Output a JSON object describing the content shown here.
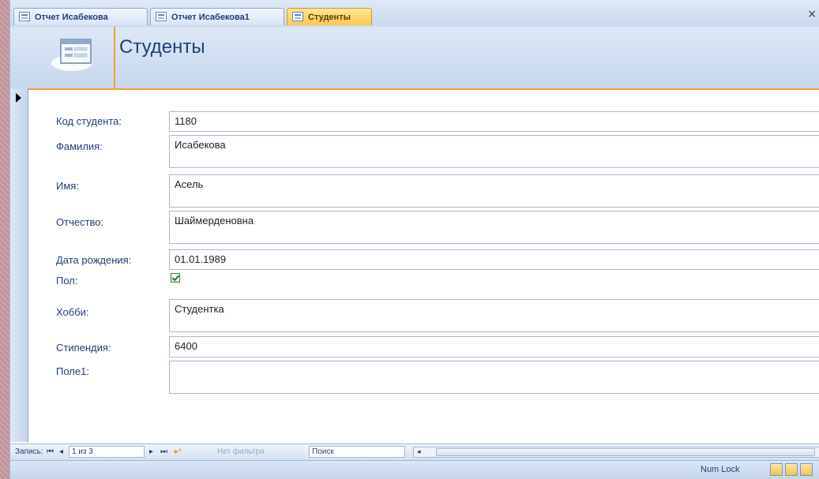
{
  "tabs": [
    {
      "label": "Отчет Исабекова",
      "active": false
    },
    {
      "label": "Отчет Исабекова1",
      "active": false
    },
    {
      "label": "Студенты",
      "active": true
    }
  ],
  "close_label": "×",
  "form": {
    "title": "Студенты",
    "fields": {
      "student_code": {
        "label": "Код студента:",
        "value": "1180"
      },
      "last_name": {
        "label": "Фамилия:",
        "value": "Исабекова"
      },
      "first_name": {
        "label": "Имя:",
        "value": "Асель"
      },
      "patronymic": {
        "label": "Отчество:",
        "value": "Шаймерденовна"
      },
      "birth_date": {
        "label": "Дата рождения:",
        "value": "01.01.1989"
      },
      "gender": {
        "label": "Пол:",
        "checked": true
      },
      "hobby": {
        "label": "Хобби:",
        "value": "Студентка"
      },
      "scholarship": {
        "label": "Стипендия:",
        "value": "6400"
      },
      "field1": {
        "label": "Поле1:",
        "value": ""
      }
    }
  },
  "navbar": {
    "records_label": "Запись:",
    "first_glyph": "⏮",
    "prev_glyph": "◂",
    "position": "1 из 3",
    "next_glyph": "▸",
    "last_glyph": "⏭",
    "new_glyph": "▸*",
    "filter_label": "Нет фильтра",
    "search_label": "Поиск",
    "scroll_left_glyph": "◂"
  },
  "statusbar": {
    "numlock": "Num Lock"
  },
  "colors": {
    "accent": "#f0a22e",
    "title": "#1e3f73",
    "background": "#c79aa0"
  }
}
